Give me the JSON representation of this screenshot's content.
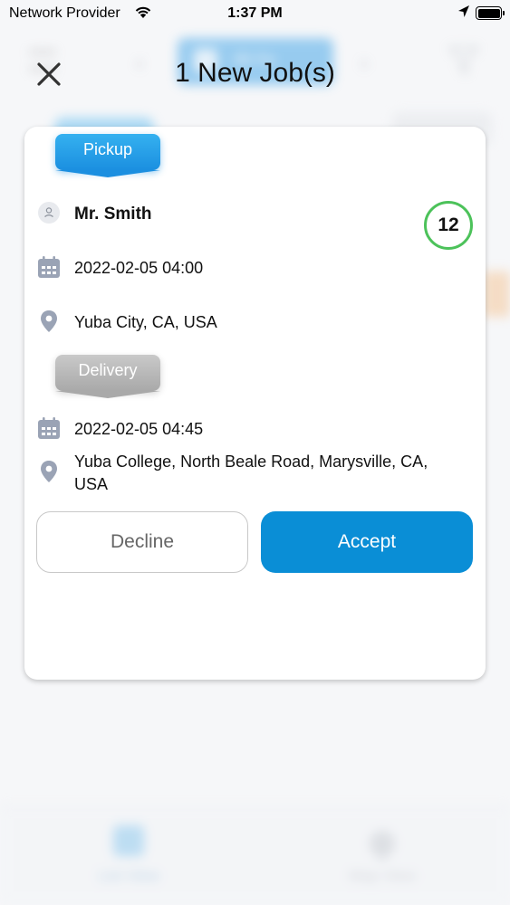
{
  "status_bar": {
    "carrier": "Network Provider",
    "time": "1:37 PM"
  },
  "background": {
    "date_pill": "05 Fe",
    "tabs": [
      {
        "label": "List View"
      },
      {
        "label": "Map View"
      }
    ]
  },
  "header": {
    "title": "1 New Job(s)"
  },
  "job": {
    "pickup_tag": "Pickup",
    "customer_name": "Mr. Smith",
    "count_badge": "12",
    "pickup_datetime": "2022-02-05 04:00",
    "pickup_address": "Yuba City, CA, USA",
    "delivery_tag": "Delivery",
    "delivery_datetime": "2022-02-05 04:45",
    "delivery_address": "Yuba College, North Beale Road, Marysville, CA, USA"
  },
  "actions": {
    "decline_label": "Decline",
    "accept_label": "Accept"
  },
  "colors": {
    "accent": "#0a8ed6",
    "pickup_tag": "#1b8fe0",
    "delivery_tag": "#a9a9a9",
    "badge_ring": "#4cc25a"
  }
}
